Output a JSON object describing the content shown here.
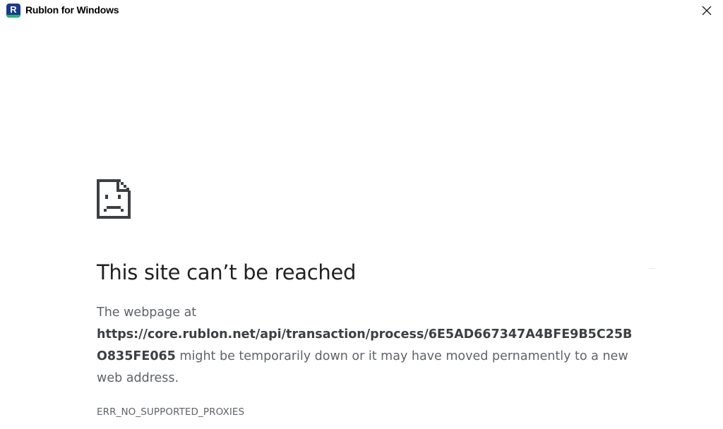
{
  "window": {
    "title": "Rublon for Windows",
    "logo_letter": "R",
    "logo_color": "#1a3a8f",
    "logo_accent_color": "#22b86a",
    "close_icon": "close-icon"
  },
  "error": {
    "icon": "sad-page-icon",
    "heading": "This site can’t be reached",
    "prefix": "The webpage at ",
    "url": "https://core.rublon.net/api/transaction/process/6E5AD667347A4BFE9B5C25BO835FE065",
    "suffix": " might be temporarily down or it may have moved pernamently to a new web address.",
    "code": "ERR_NO_SUPPORTED_PROXIES"
  }
}
